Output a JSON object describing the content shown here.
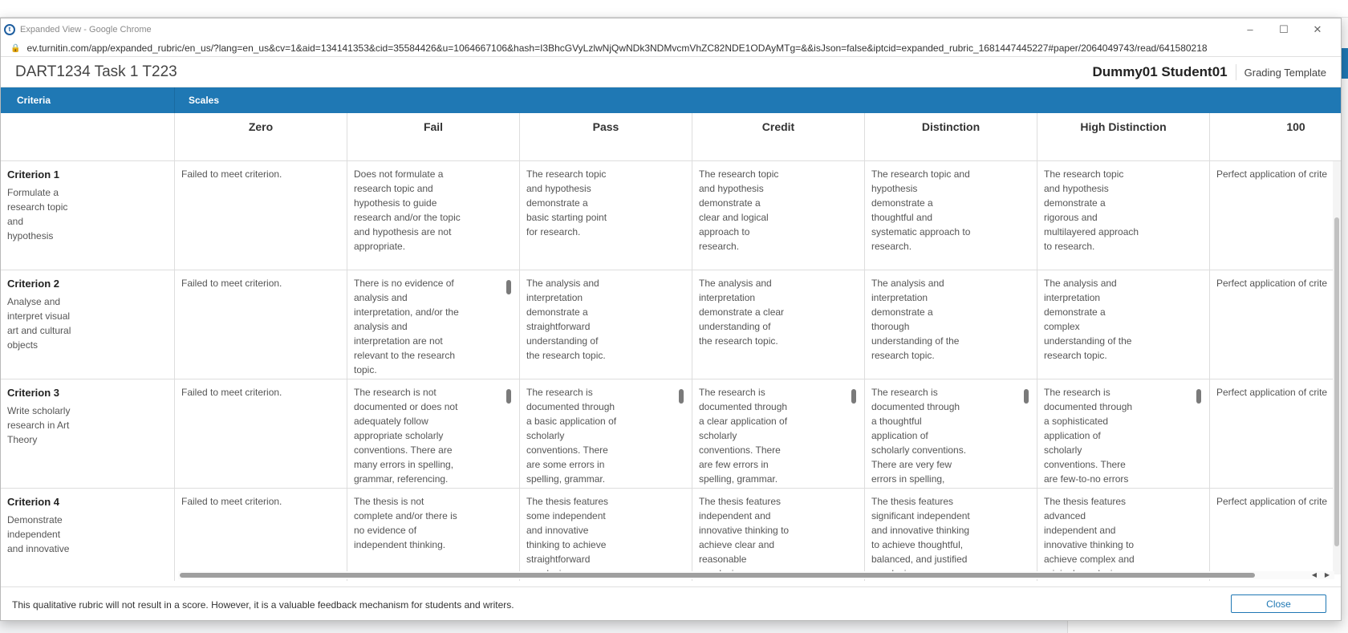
{
  "window": {
    "title": "Expanded View - Google Chrome",
    "url": "ev.turnitin.com/app/expanded_rubric/en_us/?lang=en_us&cv=1&aid=134141353&cid=35584426&u=1064667106&hash=I3BhcGVyLzlwNjQwNDk3NDMvcmVhZC82NDE1ODAyMTg=&&isJson=false&iptcid=expanded_rubric_1681447445227#paper/2064049743/read/641580218"
  },
  "header": {
    "assignment_title": "DART1234 Task 1 T223",
    "student_name": "Dummy01 Student01",
    "template_label": "Grading Template"
  },
  "table_header": {
    "criteria_label": "Criteria",
    "scales_label": "Scales"
  },
  "scales": [
    "Zero",
    "Fail",
    "Pass",
    "Credit",
    "Distinction",
    "High Distinction",
    "100"
  ],
  "criteria": [
    {
      "name": "Criterion 1",
      "desc": "Formulate a research topic and hypothesis",
      "cells": [
        "Failed to meet criterion.",
        "Does not formulate a research topic and hypothesis to guide research and/or the topic and hypothesis are not appropriate.",
        "The research topic and hypothesis demonstrate a basic starting point for research.",
        "The research topic and hypothesis demonstrate a clear and logical approach to research.",
        "The research topic and hypothesis demonstrate a thoughtful and systematic approach to research.",
        "The research topic and hypothesis demonstrate a rigorous and multilayered approach to research.",
        "Perfect application of crite"
      ]
    },
    {
      "name": "Criterion 2",
      "desc": "Analyse and interpret visual art and cultural objects",
      "cells": [
        "Failed to meet criterion.",
        "There is no evidence of analysis and interpretation, and/or the analysis and interpretation are not relevant to the research topic.",
        "The analysis and interpretation demonstrate a straightforward understanding of the research topic.",
        "The analysis and interpretation demonstrate a clear understanding of the research topic.",
        "The analysis and interpretation demonstrate a thorough understanding of the research topic.",
        "The analysis and interpretation demonstrate a complex understanding of the research topic.",
        "Perfect application of crite"
      ]
    },
    {
      "name": "Criterion 3",
      "desc": "Write scholarly research in Art Theory",
      "cells": [
        "Failed to meet criterion.",
        "The research is not documented or does not adequately follow appropriate scholarly conventions. There are many errors in spelling, grammar, referencing.",
        "The research is documented through a basic application of scholarly conventions. There are some errors in spelling, grammar.",
        "The research is documented through a clear application of scholarly conventions. There are few errors in spelling, grammar.",
        "The research is documented through a thoughtful application of scholarly conventions. There are very few errors in spelling, grammar.",
        "The research is documented through a sophisticated application of scholarly conventions. There are few-to-no errors in spelling, grammar.",
        "Perfect application of crite"
      ]
    },
    {
      "name": "Criterion 4",
      "desc": "Demonstrate independent and innovative",
      "cells": [
        "Failed to meet criterion.",
        "The thesis is not complete and/or there is no evidence of independent thinking.",
        "The thesis features some independent and innovative thinking to achieve straightforward conclusions.",
        "The thesis features independent and innovative thinking to achieve clear and reasonable conclusions.",
        "The thesis features significant independent and innovative thinking to achieve thoughtful, balanced, and justified conclusions.",
        "The thesis features advanced independent and innovative thinking to achieve complex and original conclusions.",
        "Perfect application of crite"
      ]
    }
  ],
  "footer": {
    "note": "This qualitative rubric will not result in a score. However, it is a valuable feedback mechanism for students and writers.",
    "close_label": "Close"
  },
  "icons": {
    "minimize": "minimize-icon",
    "maximize": "maximize-icon",
    "close": "close-icon",
    "lock": "lock-icon"
  }
}
